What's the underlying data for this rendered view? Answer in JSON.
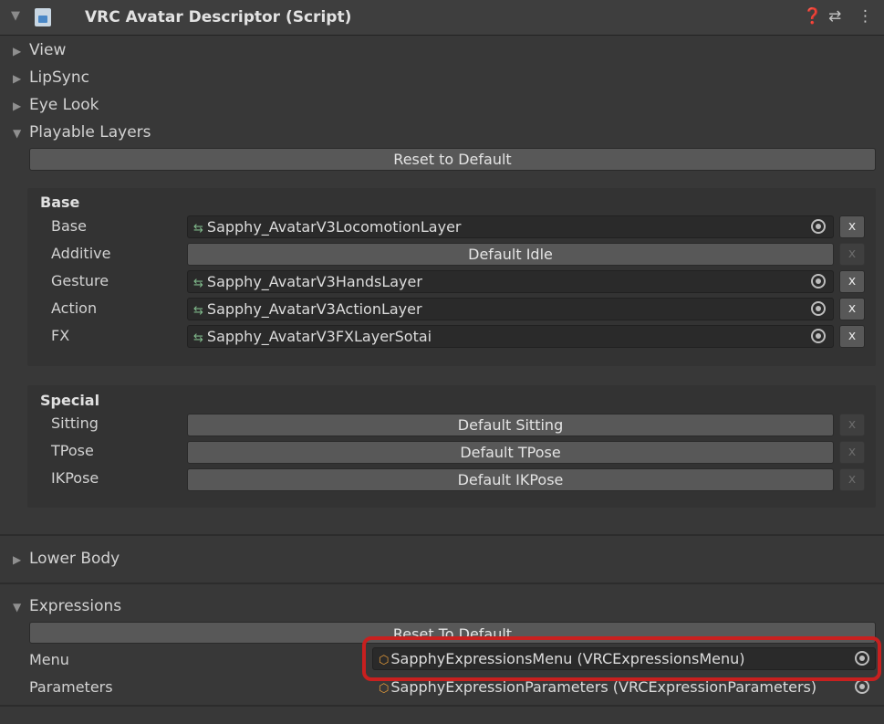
{
  "header": {
    "title": "VRC Avatar Descriptor (Script)",
    "help_icon": "help-icon",
    "settings_icon": "preset-icon",
    "menu_icon": "kebab-menu-icon"
  },
  "foldouts": {
    "view": "View",
    "lipsync": "LipSync",
    "eye_look": "Eye Look",
    "playable_layers": "Playable Layers",
    "lower_body": "Lower Body",
    "expressions": "Expressions"
  },
  "playable_layers": {
    "reset_label": "Reset to Default",
    "base_section": {
      "title": "Base",
      "rows": [
        {
          "label": "Base",
          "value": "Sapphy_AvatarV3LocomotionLayer"
        },
        {
          "label": "Additive",
          "value": "Default Idle"
        },
        {
          "label": "Gesture",
          "value": "Sapphy_AvatarV3HandsLayer"
        },
        {
          "label": "Action",
          "value": "Sapphy_AvatarV3ActionLayer"
        },
        {
          "label": "FX",
          "value": "Sapphy_AvatarV3FXLayerSotai"
        }
      ]
    },
    "special_section": {
      "title": "Special",
      "rows": [
        {
          "label": "Sitting",
          "value": "Default Sitting"
        },
        {
          "label": "TPose",
          "value": "Default TPose"
        },
        {
          "label": "IKPose",
          "value": "Default IKPose"
        }
      ]
    },
    "x_label": "x"
  },
  "expressions": {
    "reset_label": "Reset To Default",
    "menu_label": "Menu",
    "menu_value": "SapphyExpressionsMenu (VRCExpressionsMenu)",
    "parameters_label": "Parameters",
    "parameters_value": "SapphyExpressionParameters (VRCExpressionParameters)"
  },
  "colors": {
    "highlight": "#c8201f",
    "background": "#383838"
  }
}
